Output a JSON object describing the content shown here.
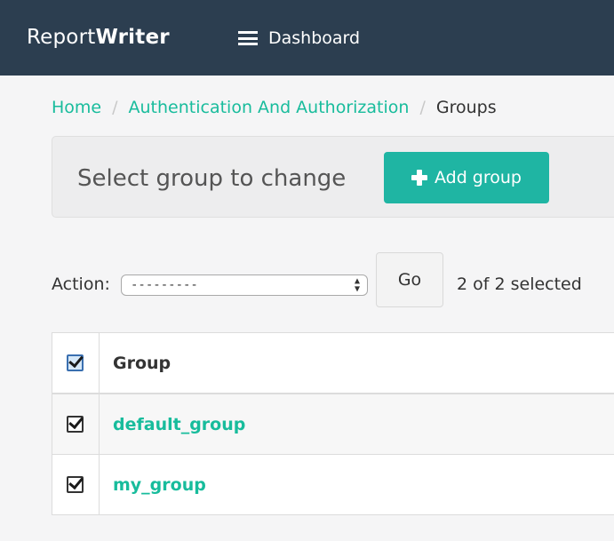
{
  "navbar": {
    "brand_prefix": "Report",
    "brand_bold": "Writer",
    "dashboard_label": "Dashboard"
  },
  "breadcrumb": {
    "home": "Home",
    "section": "Authentication And Authorization",
    "current": "Groups",
    "separator": "/"
  },
  "header": {
    "title": "Select group to change",
    "add_button_label": "Add group"
  },
  "actions": {
    "label": "Action:",
    "selected_value": "---------",
    "go_label": "Go",
    "selection_count": "2 of 2 selected"
  },
  "table": {
    "column_header": "Group",
    "rows": [
      {
        "name": "default_group",
        "checked": true
      },
      {
        "name": "my_group",
        "checked": true
      }
    ]
  },
  "colors": {
    "navbar": "#2c3e50",
    "accent": "#18bc9c",
    "add_button": "#1fb5a3"
  },
  "icons": [
    "hamburger-menu-icon",
    "plus-icon",
    "select-arrows-icon",
    "checkbox-checked-icon"
  ]
}
